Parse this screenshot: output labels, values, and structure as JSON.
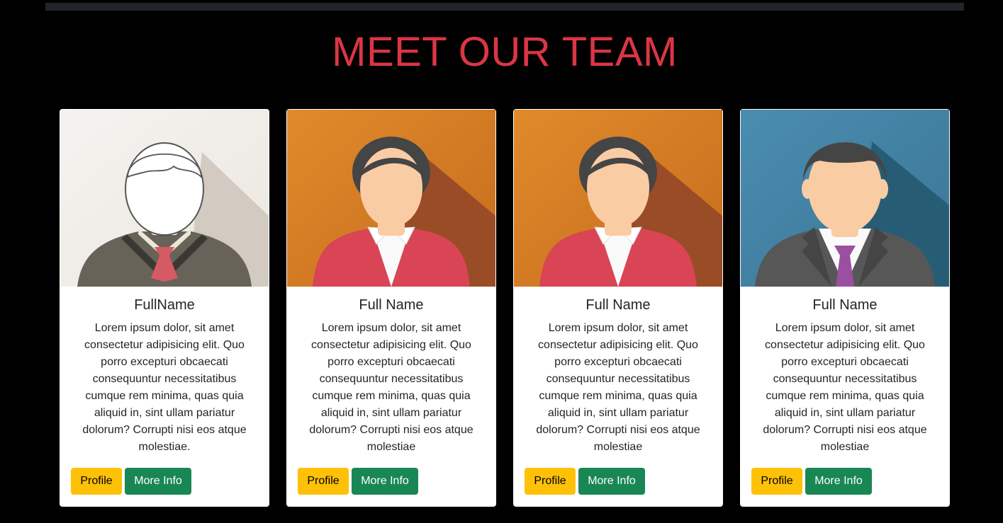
{
  "page": {
    "title": "MEET OUR TEAM"
  },
  "colors": {
    "background": "#000000",
    "title": "#dc3545",
    "profile_button": "#ffc107",
    "more_info_button": "#198754"
  },
  "team": [
    {
      "avatar": "male-sweater-outline-avatar",
      "name": "FullName",
      "bio": "Lorem ipsum dolor, sit amet consectetur adipisicing elit. Quo porro excepturi obcaecati consequuntur necessitatibus cumque rem minima, quas quia aliquid in, sint ullam pariatur dolorum? Corrupti nisi eos atque molestiae.",
      "profile_label": "Profile",
      "more_info_label": "More Info"
    },
    {
      "avatar": "female-red-blazer-avatar",
      "name": "Full Name",
      "bio": "Lorem ipsum dolor, sit amet consectetur adipisicing elit. Quo porro excepturi obcaecati consequuntur necessitatibus cumque rem minima, quas quia aliquid in, sint ullam pariatur dolorum? Corrupti nisi eos atque molestiae",
      "profile_label": "Profile",
      "more_info_label": "More Info"
    },
    {
      "avatar": "female-red-blazer-avatar",
      "name": "Full Name",
      "bio": "Lorem ipsum dolor, sit amet consectetur adipisicing elit. Quo porro excepturi obcaecati consequuntur necessitatibus cumque rem minima, quas quia aliquid in, sint ullam pariatur dolorum? Corrupti nisi eos atque molestiae",
      "profile_label": "Profile",
      "more_info_label": "More Info"
    },
    {
      "avatar": "male-suit-purple-tie-avatar",
      "name": "Full Name",
      "bio": "Lorem ipsum dolor, sit amet consectetur adipisicing elit. Quo porro excepturi obcaecati consequuntur necessitatibus cumque rem minima, quas quia aliquid in, sint ullam pariatur dolorum? Corrupti nisi eos atque molestiae",
      "profile_label": "Profile",
      "more_info_label": "More Info"
    }
  ]
}
